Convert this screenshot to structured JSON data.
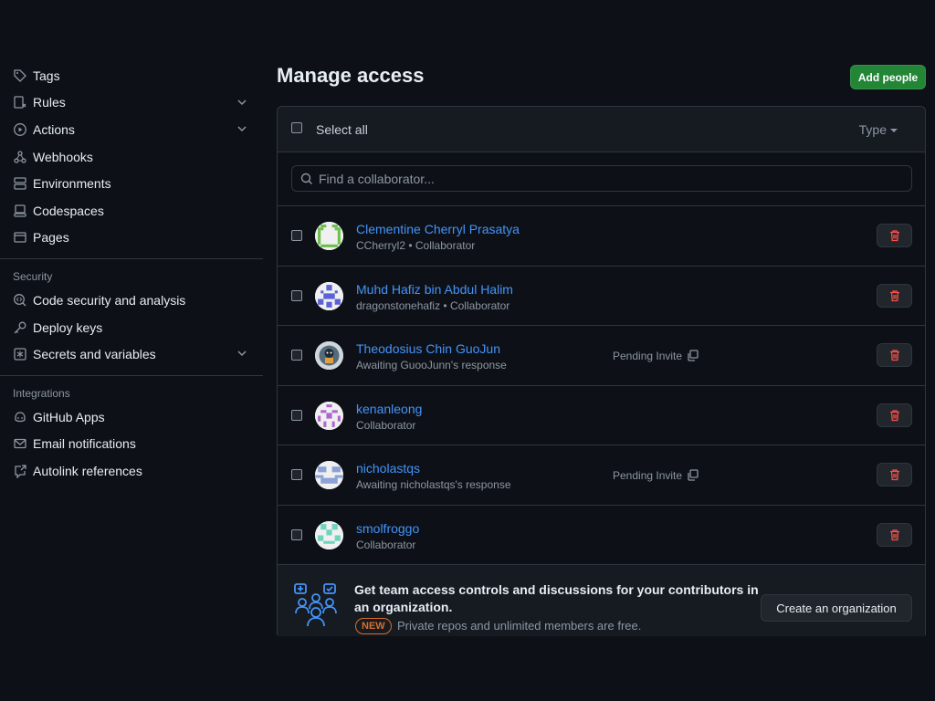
{
  "sidebar": {
    "items_top": [
      {
        "label": "Tags",
        "icon": "tag-icon"
      },
      {
        "label": "Rules",
        "icon": "rules-icon",
        "chevron": true
      },
      {
        "label": "Actions",
        "icon": "play-icon",
        "chevron": true
      },
      {
        "label": "Webhooks",
        "icon": "webhook-icon"
      },
      {
        "label": "Environments",
        "icon": "server-icon"
      },
      {
        "label": "Codespaces",
        "icon": "codespaces-icon"
      },
      {
        "label": "Pages",
        "icon": "browser-icon"
      }
    ],
    "security_heading": "Security",
    "items_security": [
      {
        "label": "Code security and analysis",
        "icon": "codescan-icon"
      },
      {
        "label": "Deploy keys",
        "icon": "key-icon"
      },
      {
        "label": "Secrets and variables",
        "icon": "asterisk-icon",
        "chevron": true
      }
    ],
    "integrations_heading": "Integrations",
    "items_integrations": [
      {
        "label": "GitHub Apps",
        "icon": "copilot-icon"
      },
      {
        "label": "Email notifications",
        "icon": "mail-icon"
      },
      {
        "label": "Autolink references",
        "icon": "cross-reference-icon"
      }
    ]
  },
  "main": {
    "title": "Manage access",
    "add_people_label": "Add people",
    "select_all_label": "Select all",
    "type_filter_label": "Type",
    "search": {
      "placeholder": "Find a collaborator..."
    },
    "collaborators": [
      {
        "name": "Clementine Cherryl Prasatya",
        "sub": "CCherryl2 • Collaborator",
        "pending": "",
        "avatar_color": "#6cc04a"
      },
      {
        "name": "Muhd Hafiz bin Abdul Halim",
        "sub": "dragonstonehafiz • Collaborator",
        "pending": "",
        "avatar_color": "#5a62d8"
      },
      {
        "name": "Theodosius Chin GuoJun",
        "sub": "Awaiting GuooJunn's response",
        "pending": "Pending Invite",
        "avatar_color": "#556b7a"
      },
      {
        "name": "kenanleong",
        "sub": "Collaborator",
        "pending": "",
        "avatar_color": "#b066d0"
      },
      {
        "name": "nicholastqs",
        "sub": "Awaiting nicholastqs's response",
        "pending": "Pending Invite",
        "avatar_color": "#8aa2d6"
      },
      {
        "name": "smolfroggo",
        "sub": "Collaborator",
        "pending": "",
        "avatar_color": "#6fd3c2"
      }
    ],
    "promo": {
      "title": "Get team access controls and discussions for your contributors in an organization.",
      "badge": "NEW",
      "subtitle": "Private repos and unlimited members are free.",
      "button_label": "Create an organization"
    }
  }
}
